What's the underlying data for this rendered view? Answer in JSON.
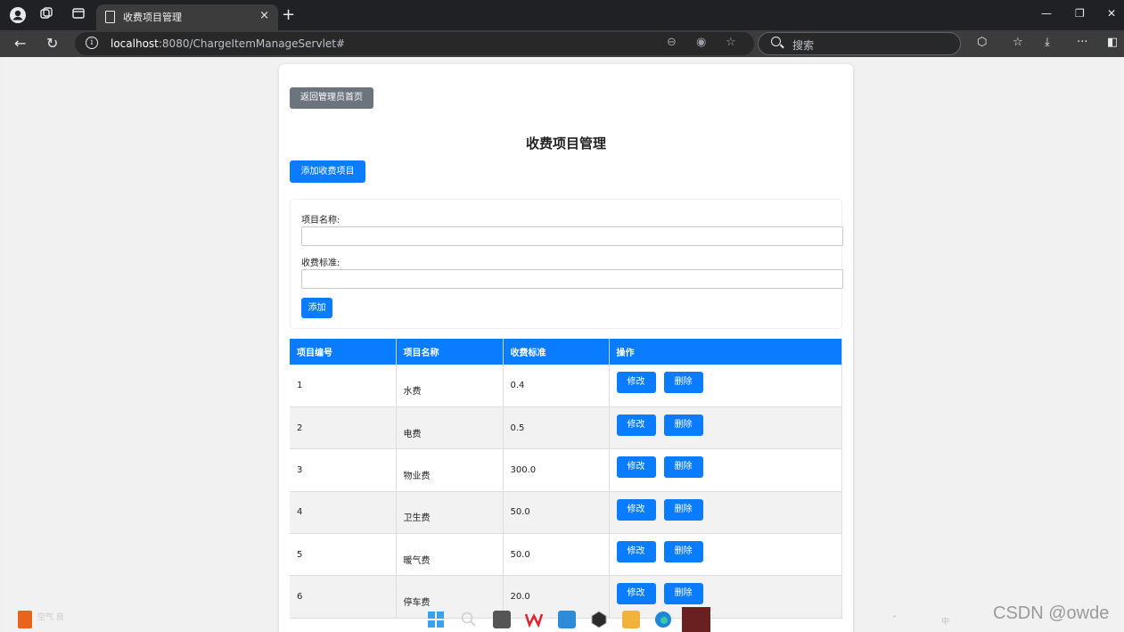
{
  "browser": {
    "tab_title": "收费项目管理",
    "tab_close": "×",
    "new_tab": "+",
    "url_host": "localhost",
    "url_path": ":8080/ChargeItemManageServlet#",
    "search_placeholder": "搜索",
    "icons": [
      "profile-icon",
      "workspaces-icon",
      "tab-actions-icon",
      "page-icon",
      "back-icon",
      "refresh-icon",
      "site-info-icon",
      "zoom-icon",
      "immersive-reader-icon",
      "favorite-star-icon",
      "extensions-icon",
      "favorites-icon",
      "downloads-icon",
      "more-icon",
      "sidebar-icon"
    ]
  },
  "page": {
    "back_button": "返回管理员首页",
    "title": "收费项目管理",
    "add_button": "添加收费项目",
    "form": {
      "name_label": "项目名称:",
      "standard_label": "收费标准:",
      "name_value": "",
      "standard_value": "",
      "submit_label": "添加"
    },
    "table": {
      "headers": [
        "项目编号",
        "项目名称",
        "收费标准",
        "操作"
      ],
      "edit_label": "修改",
      "delete_label": "删除",
      "rows": [
        {
          "id": "1",
          "name": "水费",
          "standard": "0.4"
        },
        {
          "id": "2",
          "name": "电费",
          "standard": "0.5"
        },
        {
          "id": "3",
          "name": "物业费",
          "standard": "300.0"
        },
        {
          "id": "4",
          "name": "卫生费",
          "standard": "50.0"
        },
        {
          "id": "5",
          "name": "暖气费",
          "standard": "50.0"
        },
        {
          "id": "6",
          "name": "停车费",
          "standard": "20.0"
        }
      ]
    }
  },
  "overlay": {
    "watermark": "CSDN @owde",
    "weather_text": "空气 良",
    "tray_lang": "中"
  },
  "colors": {
    "primary": "#0a7cff",
    "secondary": "#6c757d",
    "browser_dark": "#202124"
  }
}
